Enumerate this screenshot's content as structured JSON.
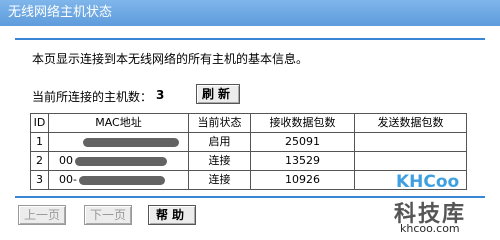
{
  "window": {
    "title": "无线网络主机状态"
  },
  "description": "本页显示连接到本无线网络的所有主机的基本信息。",
  "host_count": {
    "label": "当前所连接的主机数：",
    "value": "3"
  },
  "buttons": {
    "refresh": "刷新",
    "prev": "上一页",
    "next": "下一页",
    "help": "帮助"
  },
  "table": {
    "headers": [
      "ID",
      "MAC地址",
      "当前状态",
      "接收数据包数",
      "发送数据包数"
    ],
    "rows": [
      {
        "id": "1",
        "mac": "",
        "status": "启用",
        "rx": "25091",
        "tx": ""
      },
      {
        "id": "2",
        "mac": "00",
        "status": "连接",
        "rx": "13529",
        "tx": ""
      },
      {
        "id": "3",
        "mac": "00-",
        "status": "连接",
        "rx": "10926",
        "tx": ""
      }
    ]
  },
  "watermark": {
    "logo": "KHCoo",
    "name": "科技库",
    "url": "khcoo.com"
  },
  "colors": {
    "titlebar": "#6aa8e4",
    "rule": "#3a86d6"
  }
}
